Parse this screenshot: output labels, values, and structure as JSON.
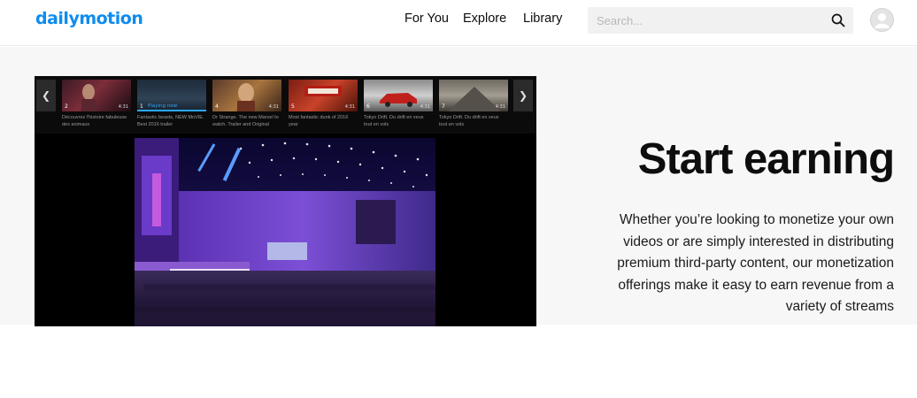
{
  "header": {
    "logo": "dailymotion",
    "nav": [
      {
        "label": "For You"
      },
      {
        "label": "Explore"
      },
      {
        "label": "Library"
      }
    ],
    "search": {
      "placeholder": "Search...",
      "value": ""
    },
    "icons": {
      "search": "search-icon",
      "avatar": "user-avatar-icon"
    }
  },
  "colors": {
    "brand": "#0d8cf0",
    "playing": "#29a9ff"
  },
  "video_strip": {
    "prev_icon": "chevron-left-icon",
    "next_icon": "chevron-right-icon",
    "playing_label": "Playing now",
    "thumbnails": [
      {
        "num": "2",
        "duration": "4:31",
        "title": "Découvrez l'histoire fabuleuse des animaux"
      },
      {
        "num": "1",
        "duration": "",
        "title": "Fantastic beasts, NEW MoVIE. Best 2016 trailer",
        "playing": true
      },
      {
        "num": "4",
        "duration": "4:31",
        "title": "Dr Strange. The new Marvel to watch. Trailer and Original"
      },
      {
        "num": "5",
        "duration": "4:31",
        "title": "Most fantastic dunk of 2016 year"
      },
      {
        "num": "6",
        "duration": "4:31",
        "title": "Tokyo Drift. Du drift en veux tout en vols"
      },
      {
        "num": "7",
        "duration": "4:31",
        "title": "Tokyo Drift. Du drift en veux tout en vols"
      }
    ]
  },
  "hero": {
    "heading": "Start earning",
    "body": "Whether you’re looking to monetize your own videos or are simply interested in distributing premium third-party content, our monetization offerings make it easy to earn revenue from a variety of streams"
  }
}
